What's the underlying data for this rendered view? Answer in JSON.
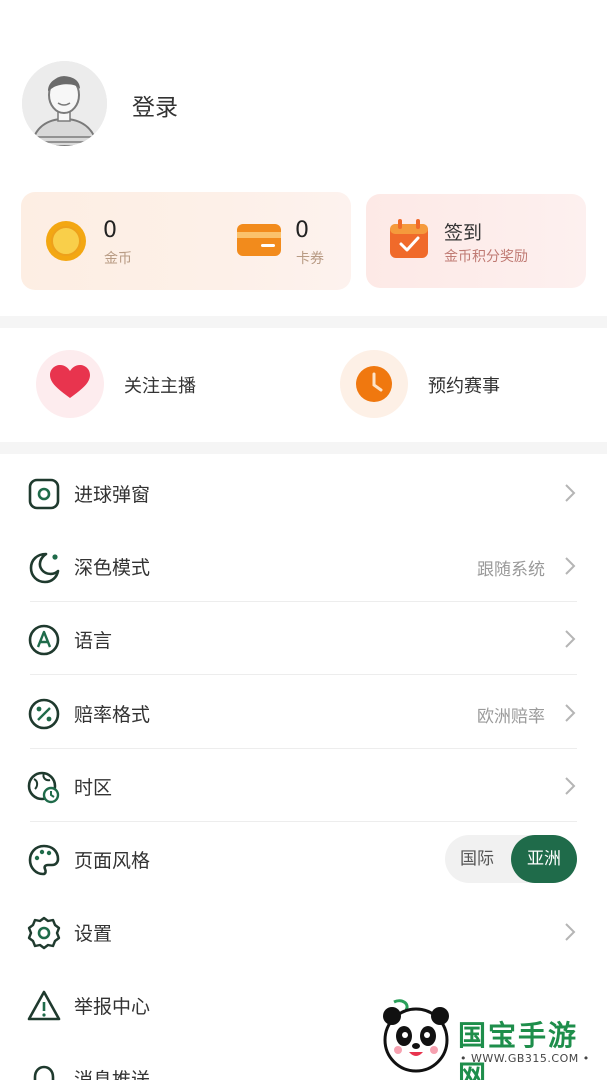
{
  "profile": {
    "login_label": "登录"
  },
  "wallet": {
    "coins": {
      "value": "0",
      "label": "金币"
    },
    "cards": {
      "value": "0",
      "label": "卡券"
    }
  },
  "checkin": {
    "title": "签到",
    "subtitle": "金币积分奖励"
  },
  "quick_actions": [
    {
      "label": "关注主播",
      "icon": "heart-icon",
      "color": "#e8344e"
    },
    {
      "label": "预约赛事",
      "icon": "clock-icon",
      "color": "#f0780f"
    }
  ],
  "menu": [
    {
      "label": "进球弹窗",
      "icon": "goal-popup-icon",
      "value": "",
      "control": "chevron"
    },
    {
      "label": "深色模式",
      "icon": "moon-icon",
      "value": "跟随系统",
      "control": "chevron"
    },
    {
      "label": "语言",
      "icon": "language-icon",
      "value": "",
      "control": "chevron"
    },
    {
      "label": "赔率格式",
      "icon": "percent-icon",
      "value": "欧洲赔率",
      "control": "chevron"
    },
    {
      "label": "时区",
      "icon": "timezone-icon",
      "value": "",
      "control": "chevron"
    },
    {
      "label": "页面风格",
      "icon": "palette-icon",
      "control": "toggle",
      "options": [
        "国际",
        "亚洲"
      ],
      "selected": "亚洲"
    },
    {
      "label": "设置",
      "icon": "gear-icon",
      "value": "",
      "control": "chevron"
    },
    {
      "label": "举报中心",
      "icon": "warning-icon",
      "value": "",
      "control": "chevron"
    },
    {
      "label": "消息推送",
      "icon": "bell-icon",
      "value": "",
      "control": "chevron"
    }
  ],
  "watermark": {
    "title": "国宝手游网",
    "url": "• WWW.GB315.COM •"
  },
  "colors": {
    "accent_green": "#1f6b4a",
    "coin_orange": "#f39c12",
    "watermark_green": "#1e8e4b"
  }
}
